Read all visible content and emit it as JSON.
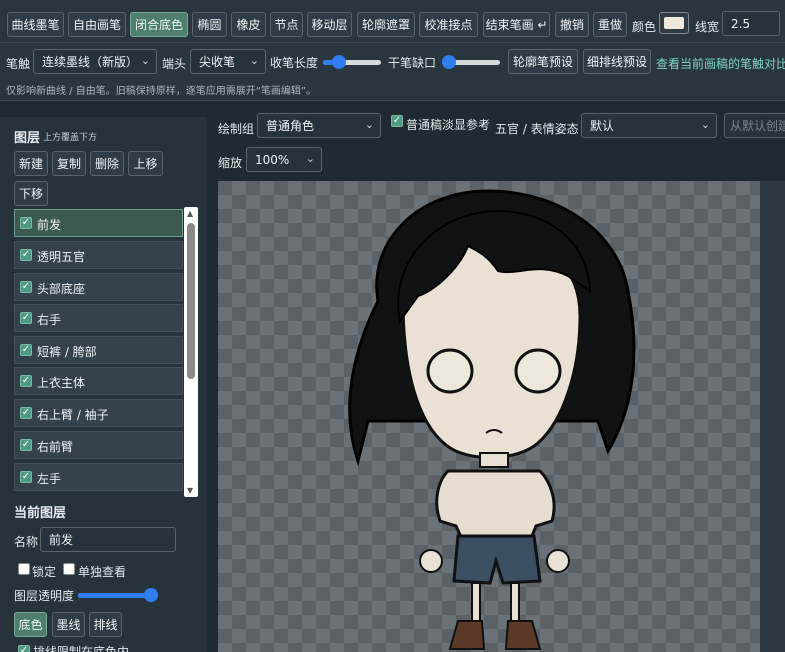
{
  "toolbar": {
    "buttons": [
      "曲线墨笔",
      "自由画笔",
      "闭合底色",
      "椭圆",
      "橡皮",
      "节点",
      "移动层",
      "轮廓遮罩",
      "校准接点",
      "结束笔画 ↵",
      "撤销",
      "重做"
    ],
    "active_button": "闭合底色",
    "color_label": "颜色",
    "color_value": "#efe9dc",
    "line_width_label": "线宽",
    "line_width_value": "2.5"
  },
  "brush_row": {
    "brush_label": "笔触",
    "brush_value": "连续墨线（新版）",
    "tip_label": "端头",
    "tip_value": "尖收笔",
    "taper_label": "收笔长度",
    "taper_level": 0.2,
    "dry_label": "干笔缺口",
    "dry_level": 0.0,
    "preset_outline": "轮廓笔预设",
    "preset_fine": "细排线预设",
    "compare_link": "查看当前画稿的笔触对比"
  },
  "hint": "仅影响新曲线 / 自由笔。旧稿保持原样，逐笔应用需展开“笔画编辑”。",
  "layers_panel": {
    "title": "图层",
    "subtitle": "上方覆盖下方",
    "buttons": {
      "new": "新建",
      "copy": "复制",
      "delete": "删除",
      "up": "上移",
      "down": "下移"
    },
    "items": [
      {
        "label": "前发",
        "checked": true,
        "selected": true
      },
      {
        "label": "透明五官",
        "checked": true
      },
      {
        "label": "头部底座",
        "checked": true
      },
      {
        "label": "右手",
        "checked": true
      },
      {
        "label": "短裤 / 胯部",
        "checked": true
      },
      {
        "label": "上衣主体",
        "checked": true
      },
      {
        "label": "右上臂 / 袖子",
        "checked": true
      },
      {
        "label": "右前臂",
        "checked": true
      },
      {
        "label": "左手",
        "checked": true
      }
    ]
  },
  "current_layer": {
    "title": "当前图层",
    "name_label": "名称",
    "name_value": "前发",
    "lock_label": "锁定",
    "solo_label": "单独查看",
    "opacity_label": "图层透明度",
    "opacity_level": 1.0,
    "mode_buttons": [
      "底色",
      "墨线",
      "排线"
    ],
    "active_mode": "底色",
    "clip_label": "排线限制在底色内"
  },
  "canvas_controls": {
    "group_label": "绘制组",
    "group_value": "普通角色",
    "ref_label": "普通稿淡显参考",
    "face_label": "五官 / 表情姿态",
    "face_value": "默认",
    "default_create": "从默认创建",
    "zoom_label": "缩放",
    "zoom_value": "100%"
  },
  "colors": {
    "accent": "#4e7f6e",
    "slider": "#2f7df0",
    "link": "#7fd6c0"
  }
}
